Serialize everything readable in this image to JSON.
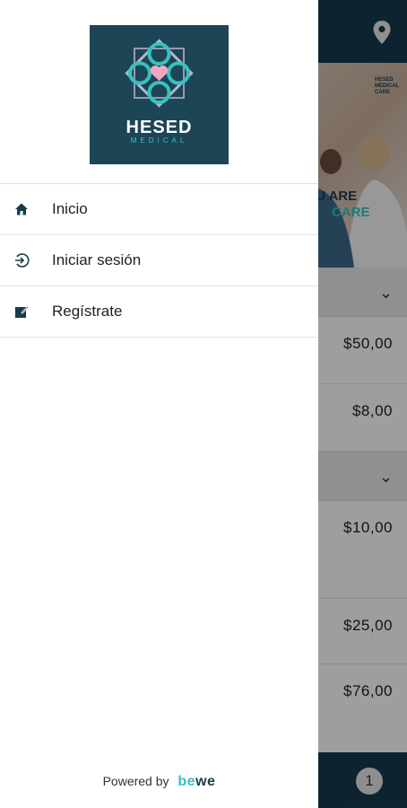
{
  "background_app": {
    "banner_text_line1": "U ARE",
    "banner_text_line2": "CARE",
    "banner_brand": "HESED MEDICAL CARE",
    "prices": [
      "$50,00",
      "$8,00",
      "$10,00",
      "$25,00",
      "$76,00"
    ],
    "cart_count": "1",
    "icons": [
      "location-pin-icon",
      "chevron-down-icon"
    ],
    "colors": {
      "topbar": "#163a4e",
      "accent": "#38c0be"
    }
  },
  "drawer": {
    "logo": {
      "name": "HESED",
      "subtitle": "MEDICAL"
    },
    "menu": [
      {
        "label": "Inicio",
        "icon": "home-icon"
      },
      {
        "label": "Iniciar sesión",
        "icon": "login-icon"
      },
      {
        "label": "Regístrate",
        "icon": "edit-icon"
      }
    ],
    "footer": {
      "powered_by": "Powered by",
      "brand_part1": "be",
      "brand_part2": "we"
    }
  }
}
